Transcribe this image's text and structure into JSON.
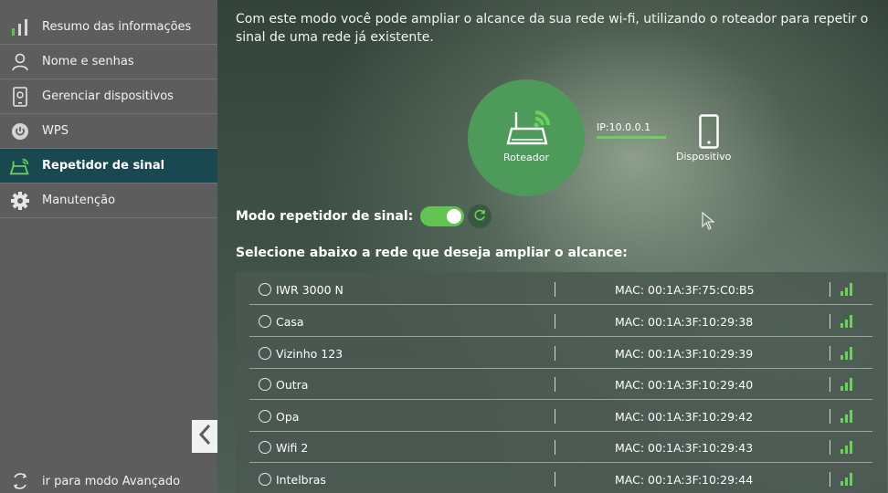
{
  "sidebar": {
    "items": [
      {
        "label": "Resumo das informações",
        "icon": "bar-chart-icon",
        "active": false
      },
      {
        "label": "Nome e senhas",
        "icon": "user-icon",
        "active": false
      },
      {
        "label": "Gerenciar dispositivos",
        "icon": "device-settings-icon",
        "active": false
      },
      {
        "label": "WPS",
        "icon": "wps-icon",
        "active": false
      },
      {
        "label": "Repetidor de sinal",
        "icon": "router-repeater-icon",
        "active": true
      },
      {
        "label": "Manutenção",
        "icon": "gear-icon",
        "active": false
      }
    ],
    "advanced_link": "ir para modo Avançado"
  },
  "main": {
    "intro": "Com este modo você pode ampliar o alcance da sua rede wi-fi, utilizando o roteador para repetir o sinal de uma rede já existente.",
    "diagram": {
      "router_label": "Roteador",
      "ip_label": "IP:10.0.0.1",
      "device_label": "Dispositivo"
    },
    "mode_label": "Modo repetidor de sinal:",
    "mode_enabled": true,
    "select_title": "Selecione abaixo a rede que deseja ampliar o alcance:",
    "networks": [
      {
        "ssid": "IWR 3000 N",
        "mac": "MAC: 00:1A:3F:75:C0:B5"
      },
      {
        "ssid": "Casa",
        "mac": "MAC: 00:1A:3F:10:29:38"
      },
      {
        "ssid": "Vizinho 123",
        "mac": "MAC: 00:1A:3F:10:29:39"
      },
      {
        "ssid": "Outra",
        "mac": "MAC: 00:1A:3F:10:29:40"
      },
      {
        "ssid": "Opa",
        "mac": "MAC: 00:1A:3F:10:29:42"
      },
      {
        "ssid": "Wifi 2",
        "mac": "MAC: 00:1A:3F:10:29:43"
      },
      {
        "ssid": "Intelbras",
        "mac": "MAC: 00:1A:3F:10:29:44"
      }
    ]
  },
  "colors": {
    "accent": "#63c354",
    "sidebar_bg": "#5c5d5c",
    "active_item_bg": "#1a4850",
    "router_circle": "#4e9a5a"
  }
}
